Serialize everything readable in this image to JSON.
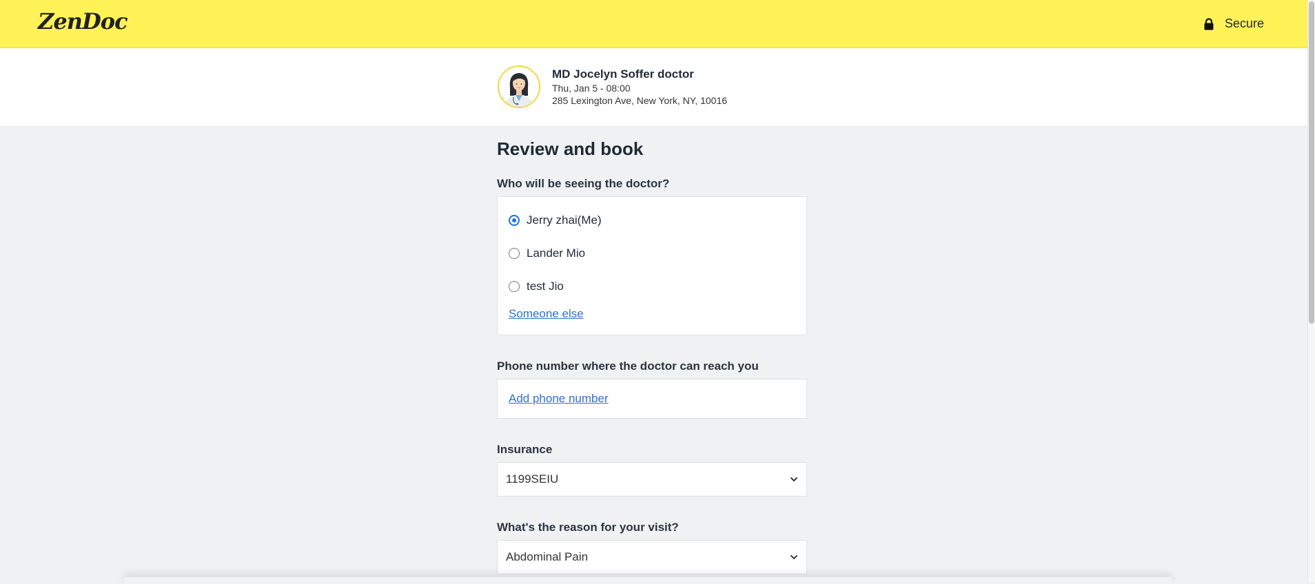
{
  "header": {
    "logo": "ZenDoc",
    "secure_label": "Secure"
  },
  "doctor": {
    "name": "MD Jocelyn Soffer doctor",
    "appointment_time": "Thu, Jan 5 - 08:00",
    "address": "285 Lexington Ave, New York, NY, 10016"
  },
  "form": {
    "title": "Review and book",
    "patient_label": "Who will be seeing the doctor?",
    "patients": [
      {
        "name": "Jerry zhai(Me)",
        "selected": true
      },
      {
        "name": "Lander Mio",
        "selected": false
      },
      {
        "name": "test Jio",
        "selected": false
      }
    ],
    "someone_else": "Someone else",
    "phone_label": "Phone number where the doctor can reach you",
    "add_phone": "Add phone number",
    "insurance_label": "Insurance",
    "insurance_value": "1199SEIU",
    "reason_label": "What's the reason for your visit?",
    "reason_value": "Abdominal Pain"
  },
  "colors": {
    "header_bg": "#fff257",
    "link": "#2f6fd0",
    "radio_checked": "#1a73e8",
    "page_bg": "#f0f1f3"
  }
}
